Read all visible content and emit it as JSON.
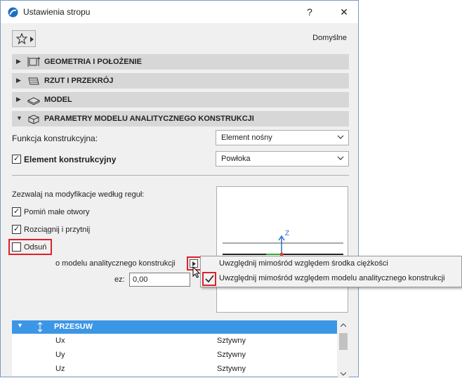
{
  "window": {
    "title": "Ustawienia stropu",
    "help_label": "?",
    "close_label": "✕"
  },
  "toolbar": {
    "favorites_icon": "star-icon",
    "defaults_label": "Domyślne"
  },
  "sections": [
    {
      "label": "GEOMETRIA I POŁOŻENIE",
      "icon": "geometry-icon",
      "expanded": false
    },
    {
      "label": "RZUT I PRZEKRÓJ",
      "icon": "floorplan-icon",
      "expanded": false
    },
    {
      "label": "MODEL",
      "icon": "model-icon",
      "expanded": false
    },
    {
      "label": "PARAMETRY MODELU ANALITYCZNEGO KONSTRUKCJI",
      "icon": "analytical-icon",
      "expanded": true
    }
  ],
  "structural": {
    "function_label": "Funkcja konstrukcyjna:",
    "function_value": "Element nośny",
    "element_label": "Element konstrukcyjny",
    "element_checked": true,
    "element_value": "Powłoka"
  },
  "rules": {
    "heading": "Zezwalaj na modyfikacje według reguł:",
    "opt1_label": "Pomiń małe otwory",
    "opt1_checked": true,
    "opt2_label": "Rozciągnij i przytnij",
    "opt2_checked": true,
    "opt3_label": "Odsuń",
    "opt3_checked": false,
    "offset_label": "o modelu analitycznego konstrukcji",
    "ez_label": "ez:",
    "ez_value": "0,00"
  },
  "preview": {
    "axis_label": "Z"
  },
  "menu": {
    "item1": "Uwzględnij mimośród względem środka ciężkości",
    "item2": "Uwzględnij mimośród względem modelu analitycznego konstrukcji",
    "item2_checked": true
  },
  "table": {
    "header": "PRZESUW",
    "rows": [
      {
        "axis": "Ux",
        "value": "Sztywny"
      },
      {
        "axis": "Uy",
        "value": "Sztywny"
      },
      {
        "axis": "Uz",
        "value": "Sztywny"
      }
    ]
  },
  "colors": {
    "accent": "#3c96e6",
    "highlight_border": "#e0202a"
  }
}
